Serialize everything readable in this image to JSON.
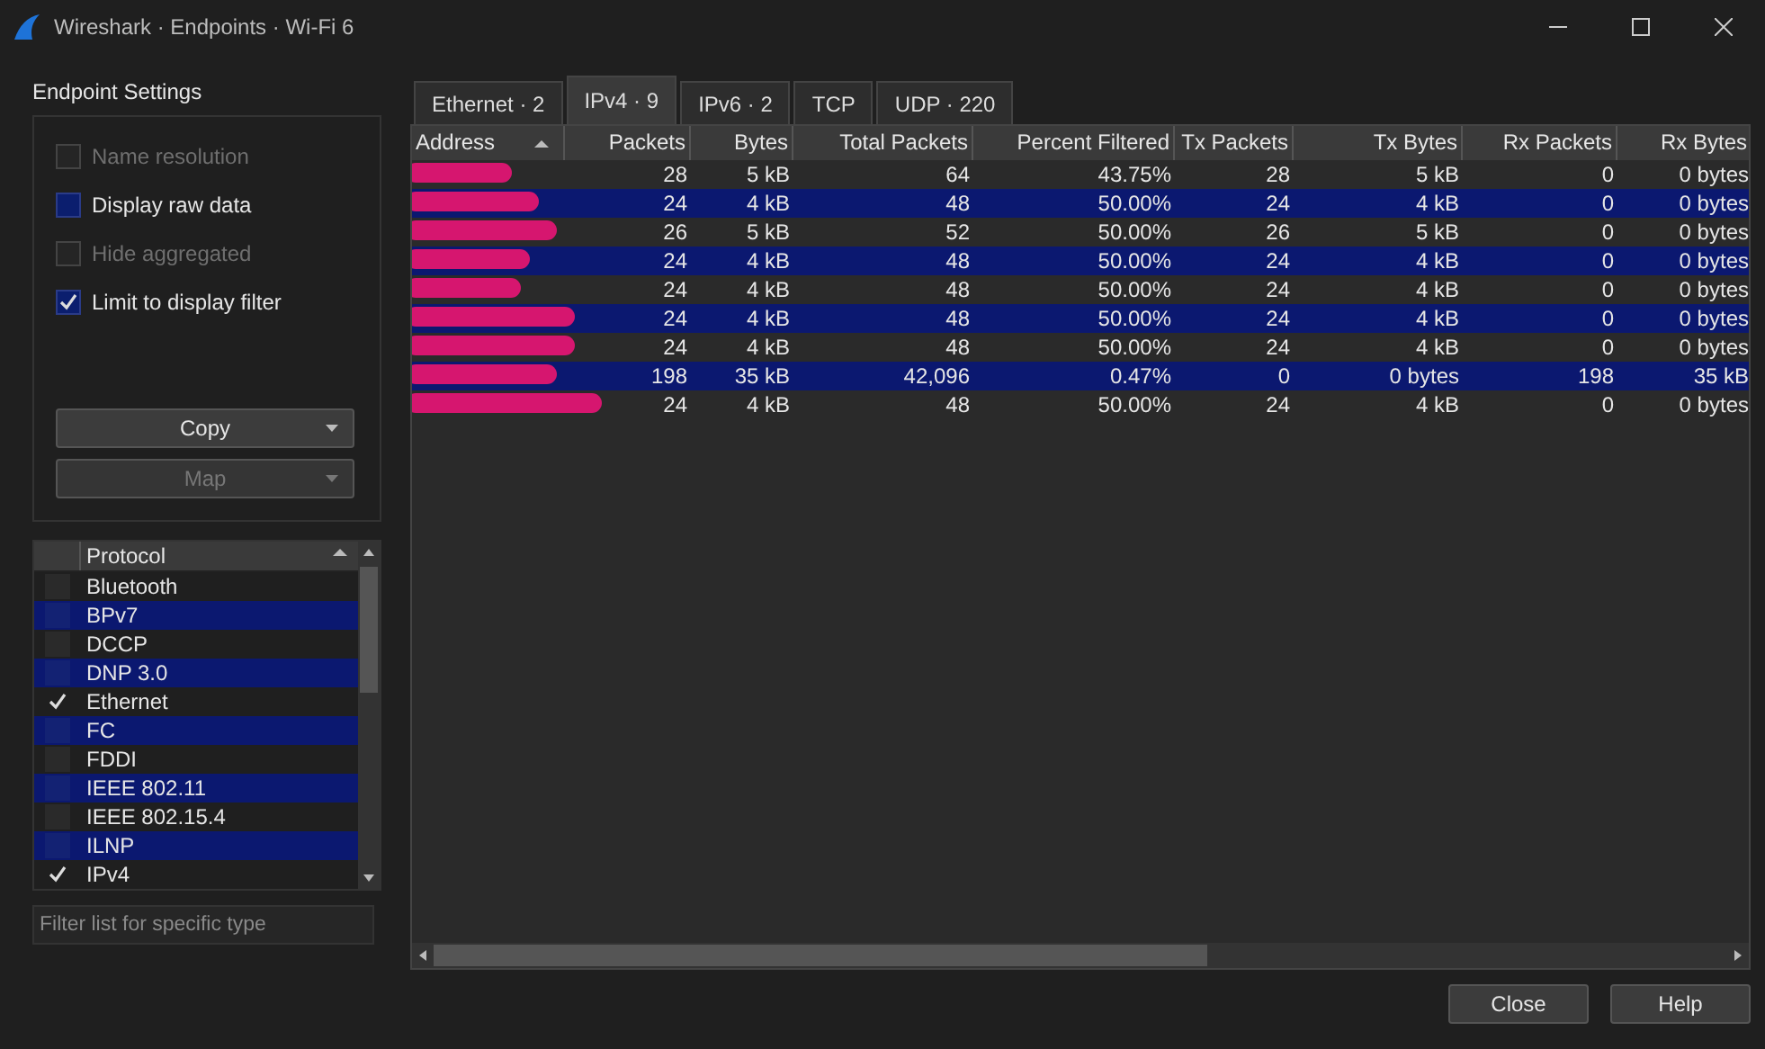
{
  "window": {
    "title": "Wireshark · Endpoints · Wi-Fi 6"
  },
  "settings": {
    "title": "Endpoint Settings",
    "options": [
      {
        "label": "Name resolution",
        "checked": false,
        "disabled": true
      },
      {
        "label": "Display raw data",
        "checked": false,
        "disabled": false
      },
      {
        "label": "Hide aggregated",
        "checked": false,
        "disabled": true
      },
      {
        "label": "Limit to display filter",
        "checked": true,
        "disabled": false
      }
    ],
    "buttons": [
      {
        "label": "Copy",
        "disabled": false
      },
      {
        "label": "Map",
        "disabled": true
      }
    ]
  },
  "protocols": {
    "column": "Protocol",
    "items": [
      {
        "name": "Bluetooth",
        "checked": false
      },
      {
        "name": "BPv7",
        "checked": false
      },
      {
        "name": "DCCP",
        "checked": false
      },
      {
        "name": "DNP 3.0",
        "checked": false
      },
      {
        "name": "Ethernet",
        "checked": true
      },
      {
        "name": "FC",
        "checked": false
      },
      {
        "name": "FDDI",
        "checked": false
      },
      {
        "name": "IEEE 802.11",
        "checked": false
      },
      {
        "name": "IEEE 802.15.4",
        "checked": false
      },
      {
        "name": "ILNP",
        "checked": false
      },
      {
        "name": "IPv4",
        "checked": true
      }
    ],
    "filter": {
      "placeholder": "Filter list for specific type"
    }
  },
  "tabs": [
    {
      "label": "Ethernet · 2",
      "selected": false
    },
    {
      "label": "IPv4 · 9",
      "selected": true
    },
    {
      "label": "IPv6 · 2",
      "selected": false
    },
    {
      "label": "TCP",
      "selected": false
    },
    {
      "label": "UDP · 220",
      "selected": false
    }
  ],
  "table": {
    "columns": [
      "Address",
      "Packets",
      "Bytes",
      "Total Packets",
      "Percent Filtered",
      "Tx Packets",
      "Tx Bytes",
      "Rx Packets",
      "Rx Bytes"
    ],
    "rows": [
      [
        "",
        "28",
        "5 kB",
        "64",
        "43.75%",
        "28",
        "5 kB",
        "0",
        "0 bytes"
      ],
      [
        "",
        "24",
        "4 kB",
        "48",
        "50.00%",
        "24",
        "4 kB",
        "0",
        "0 bytes"
      ],
      [
        "",
        "26",
        "5 kB",
        "52",
        "50.00%",
        "26",
        "5 kB",
        "0",
        "0 bytes"
      ],
      [
        "",
        "24",
        "4 kB",
        "48",
        "50.00%",
        "24",
        "4 kB",
        "0",
        "0 bytes"
      ],
      [
        "",
        "24",
        "4 kB",
        "48",
        "50.00%",
        "24",
        "4 kB",
        "0",
        "0 bytes"
      ],
      [
        "",
        "24",
        "4 kB",
        "48",
        "50.00%",
        "24",
        "4 kB",
        "0",
        "0 bytes"
      ],
      [
        "",
        "24",
        "4 kB",
        "48",
        "50.00%",
        "24",
        "4 kB",
        "0",
        "0 bytes"
      ],
      [
        "",
        "198",
        "35 kB",
        "42,096",
        "0.47%",
        "0",
        "0 bytes",
        "198",
        "35 kB"
      ],
      [
        "",
        "24",
        "4 kB",
        "48",
        "50.00%",
        "24",
        "4 kB",
        "0",
        "0 bytes"
      ]
    ]
  },
  "buttons": [
    "Close",
    "Help"
  ]
}
